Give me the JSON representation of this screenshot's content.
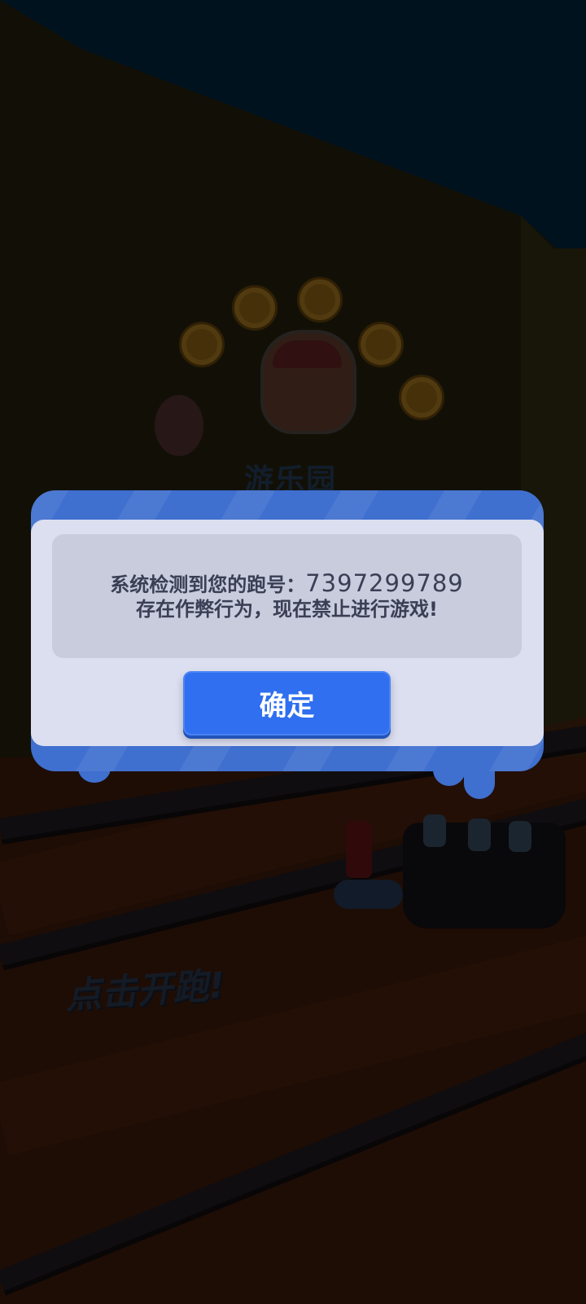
{
  "dialog": {
    "message_line1": "系统检测到您的跑号：",
    "account_number": "7397299789",
    "message_line2": "存在作弊行为，现在禁止进行游戏!",
    "confirm_label": "确定"
  },
  "background": {
    "poster_text": "游乐园",
    "tap_to_run": "点击开跑!"
  },
  "colors": {
    "dialog_frame": "#3f6fcf",
    "dialog_panel": "#dcdff0",
    "message_box": "#c9ccdd",
    "confirm_button": "#2f6ff0",
    "message_text": "#3b3f55"
  }
}
